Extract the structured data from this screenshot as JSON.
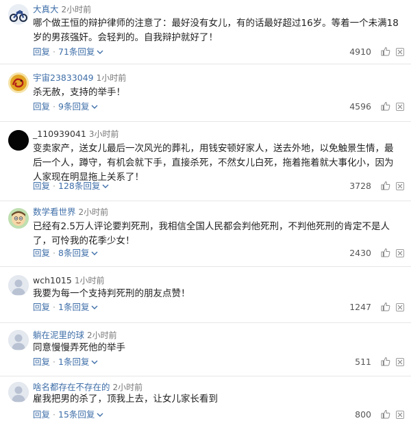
{
  "comments": [
    {
      "avatar": "motorcycle-avatar",
      "username": "大真大",
      "time": "2小时前",
      "text": "哪个做王恒的辩护律师的注意了：最好没有女儿，有的话最好超过16岁。等着一个未满18岁的男孩强奸。会轻判的。自我辩护就好了！",
      "reply": "回复",
      "reply_count": "71条回复",
      "likes": "4910"
    },
    {
      "avatar": "dragon-avatar",
      "username": "宇宙23833049",
      "time": "1小时前",
      "text": "杀无赦，支持的举手！",
      "reply": "回复",
      "reply_count": "9条回复",
      "likes": "4596"
    },
    {
      "avatar": "black-circle-avatar",
      "username": "_110939041",
      "time": "3小时前",
      "text": "变卖家产，送女儿最后一次风光的葬礼，用钱安顿好家人，送去外地，以免触景生情，最后一个人，蹲守，有机会就下手，直接杀死，不然女儿白死，拖着拖着就大事化小，因为人家现在明显拖上关系了！",
      "reply": "回复",
      "reply_count": "128条回复",
      "likes": "3728"
    },
    {
      "avatar": "cartoon-avatar",
      "username": "数学看世界",
      "time": "2小时前",
      "text": "已经有2.5万人评论要判死刑，我相信全国人民都会判他死刑，不判他死刑的肯定不是人了，可怜我的花季少女！",
      "reply": "回复",
      "reply_count": "8条回复",
      "likes": "2430"
    },
    {
      "avatar": "default-avatar",
      "username": "wch1015",
      "time": "1小时前",
      "text": "我要为每一个支持判死刑的朋友点赞！",
      "reply": "回复",
      "reply_count": "1条回复",
      "likes": "1247"
    },
    {
      "avatar": "default-avatar",
      "username": "躺在泥里的球",
      "time": "2小时前",
      "text": "同意慢慢弄死他的举手",
      "reply": "回复",
      "reply_count": "1条回复",
      "likes": "511"
    },
    {
      "avatar": "default-avatar",
      "username": "啥名都存在不存在的",
      "time": "2小时前",
      "text": "雇我把男的杀了，顶我上去，让女儿家长看到",
      "reply": "回复",
      "reply_count": "15条回复",
      "likes": "800"
    }
  ]
}
